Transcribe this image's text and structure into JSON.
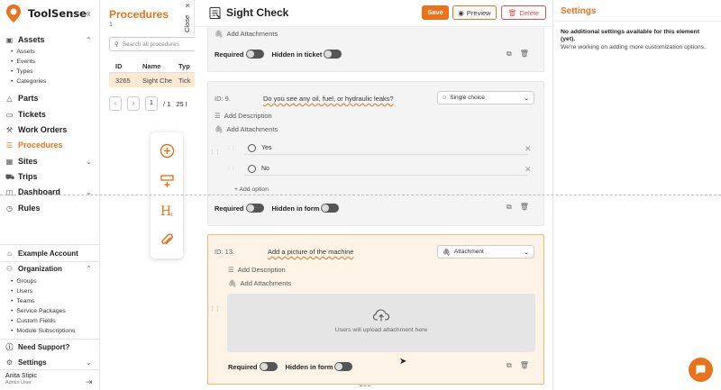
{
  "app": {
    "name": "ToolSense"
  },
  "sidebar": {
    "collapse_icon": "«",
    "assets": {
      "label": "Assets",
      "items": [
        "Assets",
        "Events",
        "Types",
        "Categories"
      ]
    },
    "nav": [
      {
        "label": "Parts"
      },
      {
        "label": "Tickets"
      },
      {
        "label": "Work Orders"
      },
      {
        "label": "Procedures"
      },
      {
        "label": "Sites"
      },
      {
        "label": "Trips"
      },
      {
        "label": "Dashboard"
      },
      {
        "label": "Rules"
      }
    ],
    "account": "Example Account",
    "organization": {
      "label": "Organization",
      "items": [
        "Groups",
        "Users",
        "Teams",
        "Service Packages",
        "Custom Fields",
        "Module Subscriptions"
      ]
    },
    "support": "Need Support?",
    "settings": "Settings",
    "user": {
      "name": "Anita Stipic",
      "role": "Admin User"
    }
  },
  "procedures": {
    "title": "Procedures",
    "count": "1",
    "search_placeholder": "Search all procedures",
    "columns": [
      "ID",
      "Name",
      "Typ"
    ],
    "row": [
      "3265",
      "Sight Che",
      "Tick"
    ],
    "page": "1",
    "pages": "/ 1",
    "per_page": "25 I"
  },
  "close_label": "Close",
  "editor": {
    "title": "Sight Check",
    "save": "Save",
    "preview": "Preview",
    "delete": "Delete",
    "top_card": {
      "add_attachments": "Add Attachments",
      "required": "Required",
      "hidden": "Hidden in ticket"
    },
    "q9": {
      "id": "ID: 9.",
      "text": "Do you see any oil, fuel, or hydraulic leaks?",
      "type": "Single choice",
      "add_description": "Add Description",
      "add_attachments": "Add Attachments",
      "options": [
        "Yes",
        "No"
      ],
      "add_option": "+ Add option",
      "required": "Required",
      "hidden": "Hidden in form"
    },
    "q13": {
      "id": "ID: 13.",
      "text": "Add a picture of the machine",
      "type": "Attachment",
      "add_description": "Add Description",
      "add_attachments": "Add Attachments",
      "upload_hint": "Users will upload attachment here",
      "required": "Required",
      "hidden": "Hidden in form"
    }
  },
  "settings": {
    "title": "Settings",
    "message": "No additional settings available for this element (yet).",
    "sub": "We're working on adding more customization options."
  }
}
